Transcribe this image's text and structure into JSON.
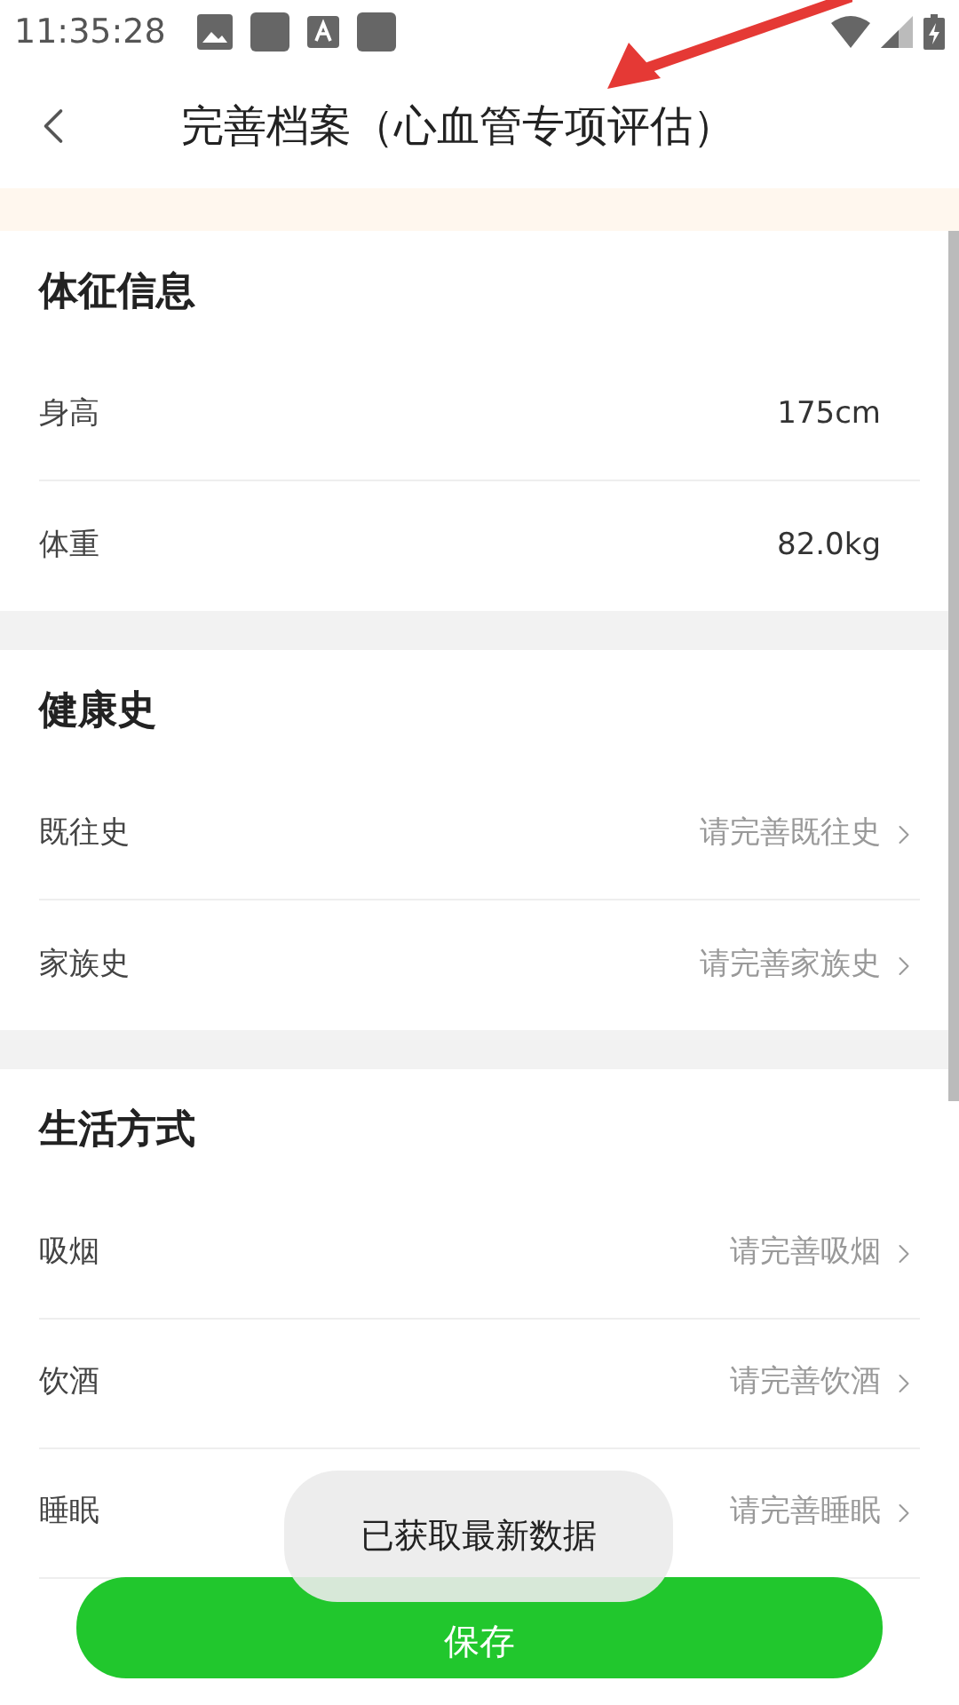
{
  "status_bar": {
    "time": "11:35:28"
  },
  "header": {
    "title": "完善档案（心血管专项评估）"
  },
  "sections": [
    {
      "title": "体征信息",
      "rows": [
        {
          "label": "身高",
          "value": "175cm",
          "kind": "value"
        },
        {
          "label": "体重",
          "value": "82.0kg",
          "kind": "value"
        }
      ]
    },
    {
      "title": "健康史",
      "rows": [
        {
          "label": "既往史",
          "value": "请完善既往史",
          "kind": "link"
        },
        {
          "label": "家族史",
          "value": "请完善家族史",
          "kind": "link"
        }
      ]
    },
    {
      "title": "生活方式",
      "rows": [
        {
          "label": "吸烟",
          "value": "请完善吸烟",
          "kind": "link"
        },
        {
          "label": "饮酒",
          "value": "请完善饮酒",
          "kind": "link"
        },
        {
          "label": "睡眠",
          "value": "请完善睡眠",
          "kind": "link"
        }
      ]
    }
  ],
  "save_button": {
    "label": "保存"
  },
  "toast": {
    "text": "已获取最新数据"
  }
}
